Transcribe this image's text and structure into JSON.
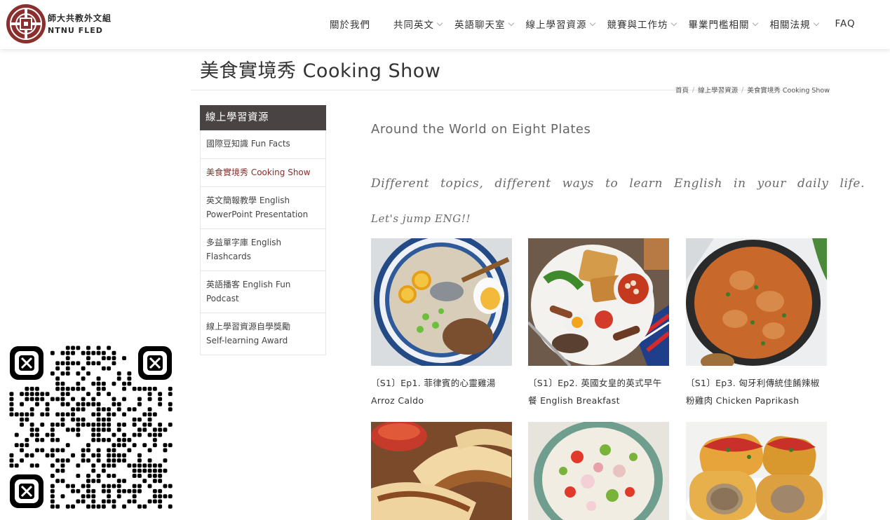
{
  "brand": {
    "zh": "師大共教外文組",
    "en": "NTNU FLED"
  },
  "nav": [
    {
      "label": "關於我們",
      "has_dropdown": false
    },
    {
      "label": "共同英文",
      "has_dropdown": true
    },
    {
      "label": "英語聊天室",
      "has_dropdown": true
    },
    {
      "label": "線上學習資源",
      "has_dropdown": true
    },
    {
      "label": "競賽與工作坊",
      "has_dropdown": true
    },
    {
      "label": "畢業門檻相關",
      "has_dropdown": true
    },
    {
      "label": "相關法規",
      "has_dropdown": true
    },
    {
      "label": "FAQ",
      "has_dropdown": false
    }
  ],
  "page": {
    "title": "美食實境秀 Cooking Show"
  },
  "breadcrumb": {
    "home": "首頁",
    "section": "線上學習資源",
    "current": "美食實境秀 Cooking Show"
  },
  "sidebar": {
    "title": "線上學習資源",
    "items": [
      {
        "line1": "國際豆知識 Fun Facts",
        "line2": ""
      },
      {
        "line1": "美食實境秀 Cooking Show",
        "line2": ""
      },
      {
        "line1": "英文簡報教學 English",
        "line2": "PowerPoint Presentation"
      },
      {
        "line1": "多益單字庫 English",
        "line2": "Flashcards"
      },
      {
        "line1": "英語播客 English Fun",
        "line2": "Podcast"
      },
      {
        "line1": "線上學習資源自學獎勵",
        "line2": "Self-learning Award"
      }
    ]
  },
  "main": {
    "heading": "Around the World on  Eight  Plates",
    "tagline": "Different  topics, different  ways  to  learn  English  in  your  daily  life.",
    "tagline2": "Let's  jump  ENG!!",
    "cards": [
      {
        "line1": "〔S1〕Ep1. 菲律賓的心靈雞湯",
        "line2": "Arroz Caldo"
      },
      {
        "line1": "〔S1〕Ep2. 英國女皇的英式早午",
        "line2": "餐 English Breakfast"
      },
      {
        "line1": "〔S1〕Ep3. 匈牙利傳統佳餚辣椒",
        "line2": "粉雞肉 Chicken Paprikash"
      },
      {
        "line1": "",
        "line2": ""
      },
      {
        "line1": "",
        "line2": ""
      },
      {
        "line1": "",
        "line2": ""
      }
    ]
  },
  "colors": {
    "sidebar_header": "#4a4343",
    "active_link": "#8b2e2e",
    "logo": "#8b2e2e"
  }
}
